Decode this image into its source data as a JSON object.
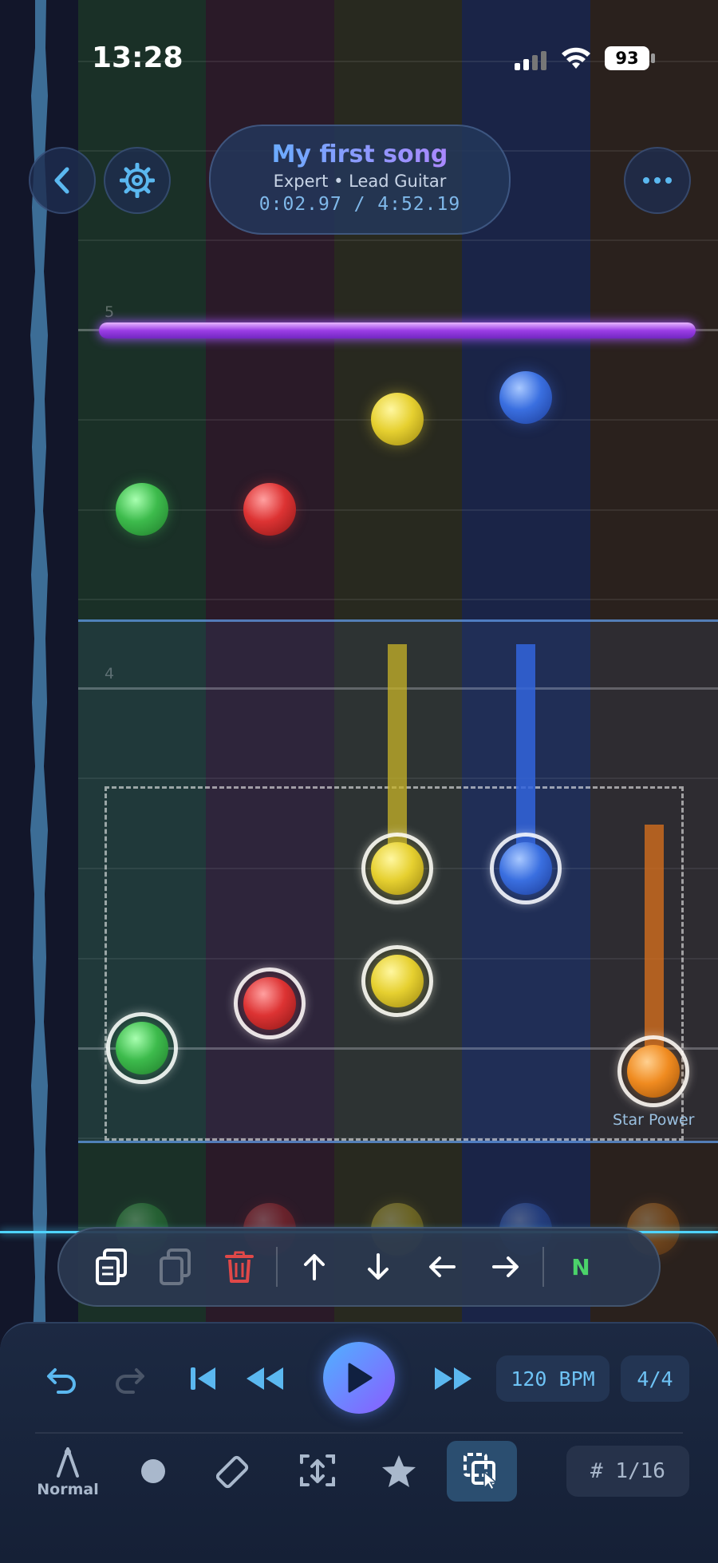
{
  "status": {
    "time": "13:28",
    "battery": "93"
  },
  "header": {
    "song_title": "My first song",
    "song_subtitle": "Expert • Lead Guitar",
    "song_time": "0:02.97 / 4:52.19",
    "back_icon": "chevron-left-icon",
    "settings_icon": "gear-icon",
    "more_icon": "ellipsis-icon"
  },
  "chart": {
    "measure_5": "5",
    "measure_4": "4",
    "star_power_label": "Star Power",
    "lane_colors": [
      "#1a3027",
      "#2a1a28",
      "#28291f",
      "#1a2447",
      "#2a211d"
    ]
  },
  "edit_toolbar": {
    "items": [
      "copy-icon",
      "paste-icon",
      "trash-icon",
      "arrow-up-icon",
      "arrow-down-icon",
      "arrow-left-icon",
      "arrow-right-icon"
    ],
    "n_label": "N"
  },
  "transport": {
    "bpm": "120 BPM",
    "time_signature": "4/4"
  },
  "tools": {
    "mode_label": "Normal",
    "snap": "# 1/16"
  },
  "colors": {
    "accent": "#4fb2ff",
    "trash": "#e04848",
    "n_green": "#4bd36a"
  }
}
